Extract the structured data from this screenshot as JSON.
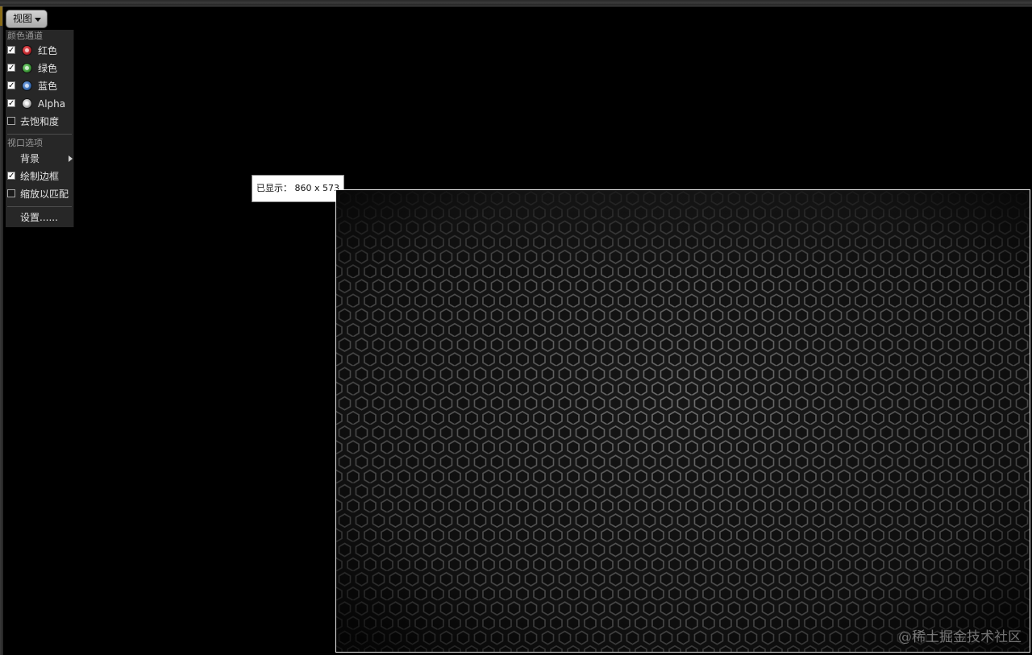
{
  "view_button": {
    "label": "视图"
  },
  "view_menu": {
    "color_channels_header": "颜色通道",
    "channels": [
      {
        "label": "红色",
        "checked": true,
        "icon": "red-channel-icon",
        "color": "#c0272d"
      },
      {
        "label": "绿色",
        "checked": true,
        "icon": "green-channel-icon",
        "color": "#3f9b3a"
      },
      {
        "label": "蓝色",
        "checked": true,
        "icon": "blue-channel-icon",
        "color": "#3b6fb5"
      },
      {
        "label": "Alpha",
        "checked": true,
        "icon": "alpha-channel-icon",
        "color": "#b5b5b5"
      }
    ],
    "desaturate": {
      "label": "去饱和度",
      "checked": false
    },
    "viewport_options_header": "视口选项",
    "background": {
      "label": "背景"
    },
    "draw_border": {
      "label": "绘制边框",
      "checked": true
    },
    "scale_to_fit": {
      "label": "缩放以匹配",
      "checked": false
    },
    "settings": {
      "label": "设置......"
    }
  },
  "tooltip": {
    "text": "已显示： 860 x 573"
  },
  "watermark": {
    "text": "@稀土掘金技术社区"
  },
  "colors": {
    "menu_bg": "#272727",
    "image_border": "#e8e8e8",
    "hex_stroke": "#6e6e6e"
  }
}
